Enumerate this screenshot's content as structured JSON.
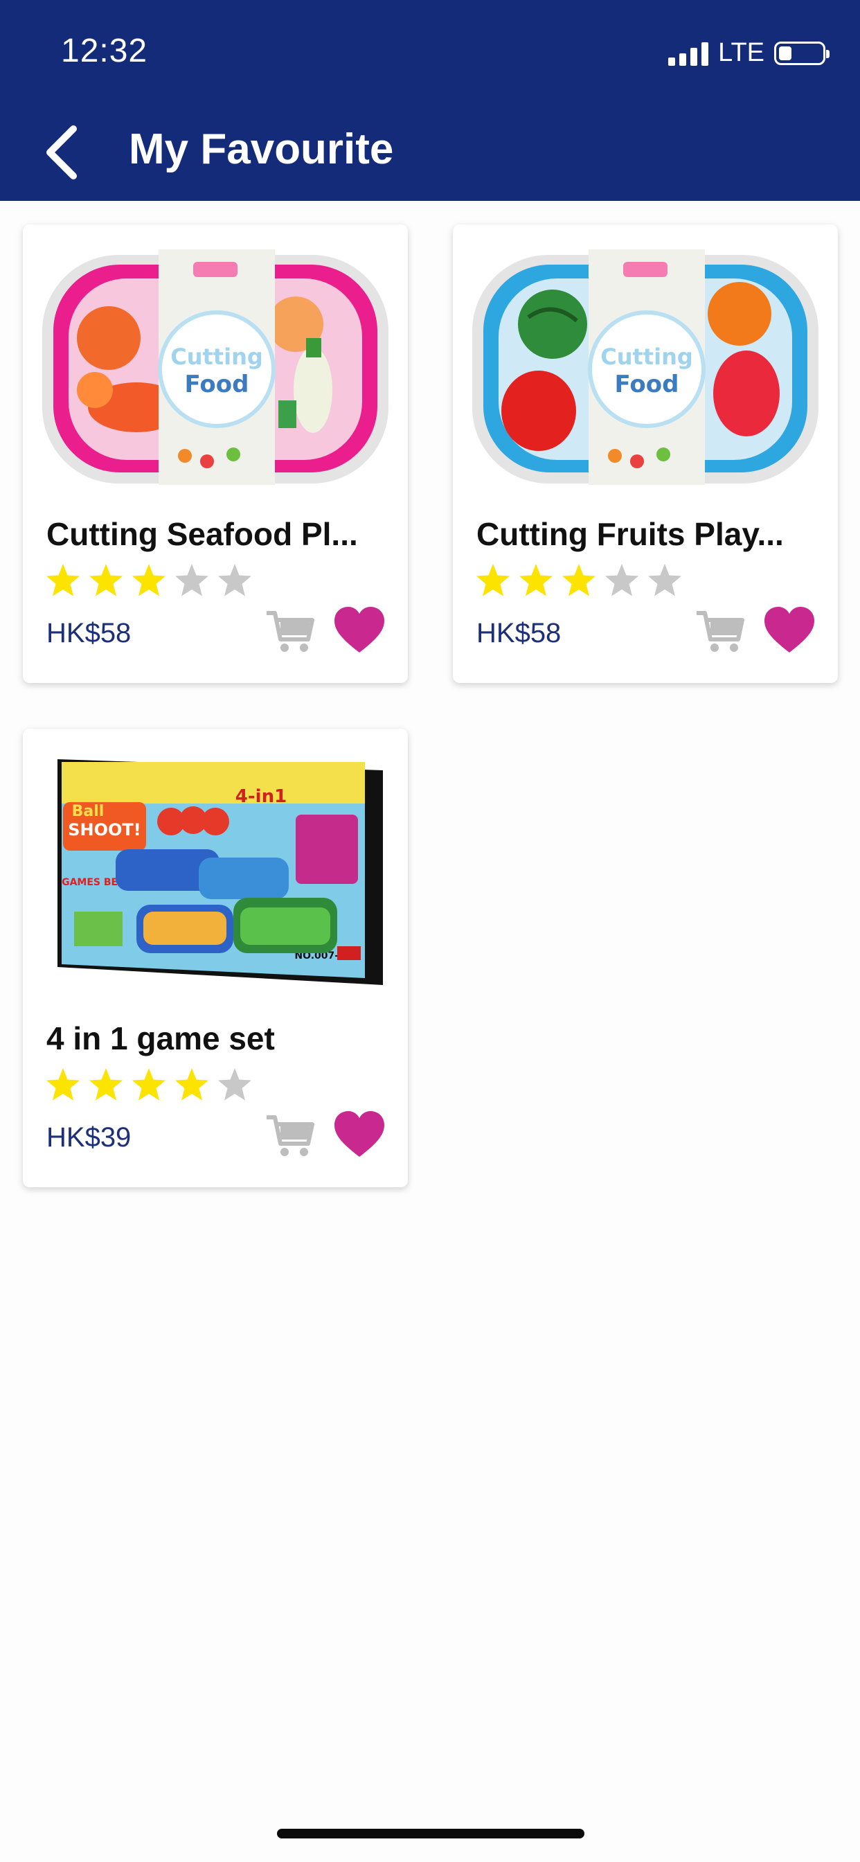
{
  "status_bar": {
    "time": "12:32",
    "network": "LTE"
  },
  "header": {
    "title": "My Favourite",
    "back_icon": "chevron-left-icon"
  },
  "colors": {
    "header_bg": "#142b7a",
    "price": "#1e2f79",
    "star_filled": "#fce300",
    "star_empty": "#c8c8c8",
    "heart": "#c9298f",
    "cart": "#bdbdbd"
  },
  "products": [
    {
      "name": "Cutting Seafood Pl...",
      "price": "HK$58",
      "rating": 3,
      "max_rating": 5,
      "favourited": true,
      "image_text": [
        "Cutting",
        "Food"
      ]
    },
    {
      "name": "Cutting Fruits Play...",
      "price": "HK$58",
      "rating": 3,
      "max_rating": 5,
      "favourited": true,
      "image_text": [
        "Cutting",
        "Food"
      ]
    },
    {
      "name": "4 in 1 game set",
      "price": "HK$39",
      "rating": 4,
      "max_rating": 5,
      "favourited": true,
      "image_text": [
        "Ball",
        "SHOOT!",
        "4-in1",
        "GAMES BEGIN!",
        "NO.007-17"
      ]
    }
  ]
}
